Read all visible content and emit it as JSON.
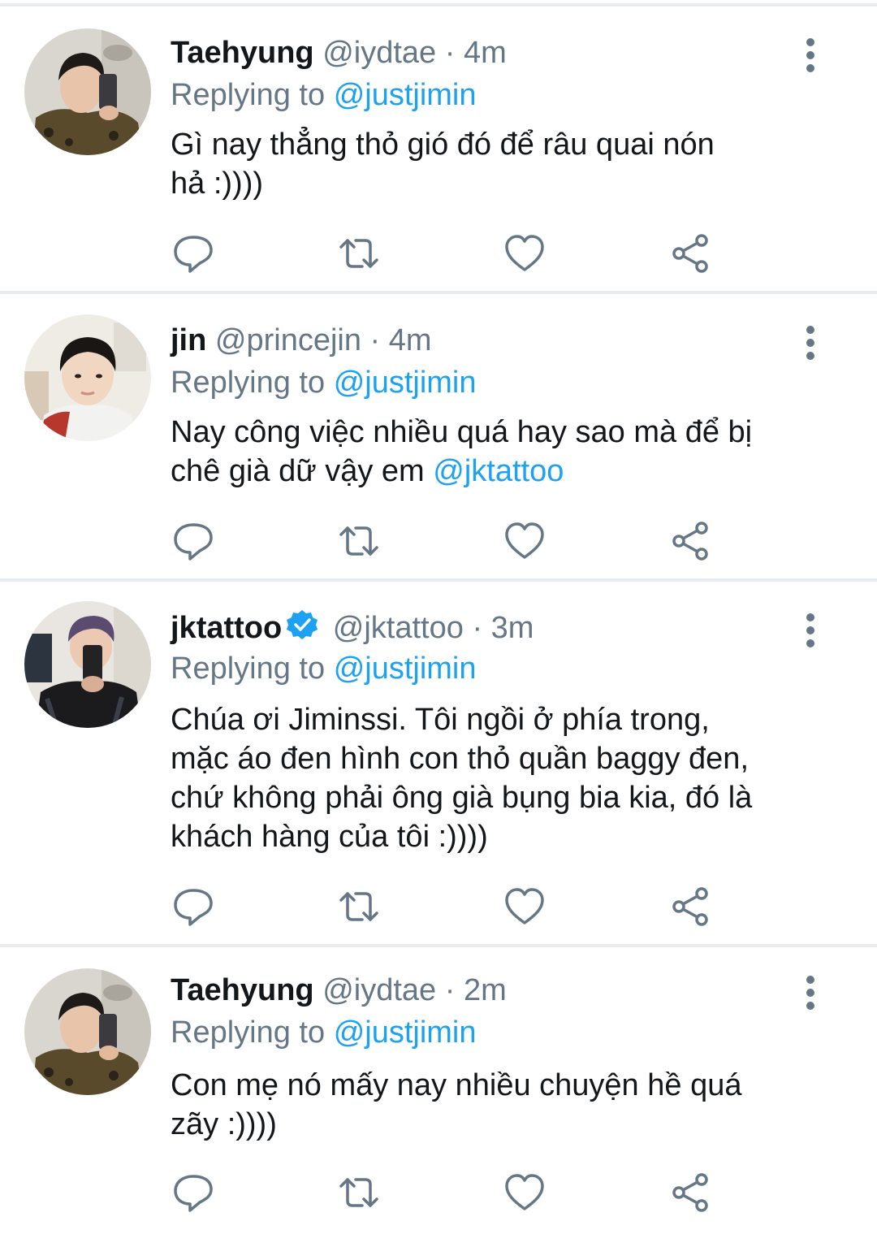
{
  "colors": {
    "name": "#14171a",
    "meta": "#657786",
    "mention": "#1da1f2",
    "separator": "#e6ecf0",
    "verified": "#1da1f2"
  },
  "icons": {
    "reply": "reply-icon",
    "retweet": "retweet-icon",
    "like": "heart-icon",
    "share": "share-icon",
    "more": "more-vertical-icon",
    "verified": "verified-badge-icon"
  },
  "tweets": [
    {
      "name": "Taehyung",
      "handle": "@iydtae",
      "dot": "·",
      "time": "4m",
      "replying_prefix": "Replying to",
      "replying_to": "@justjimin",
      "text_line1": "Gì nay thẳng thỏ gió đó để râu quai nón",
      "text_line2": "hả :))))"
    },
    {
      "name": "jin",
      "handle": "@princejin",
      "dot": "·",
      "time": "4m",
      "replying_prefix": "Replying to",
      "replying_to": "@justjimin",
      "text_line1": "Nay công việc nhiều quá hay sao mà để bị",
      "text_line2": "chê già dữ vậy em ",
      "text_mention": "@jktattoo"
    },
    {
      "name": "jktattoo",
      "verified": true,
      "handle": "@jktattoo",
      "dot": "·",
      "time": "3m",
      "replying_prefix": "Replying to",
      "replying_to": "@justjimin",
      "text_line1": "Chúa ơi Jiminssi. Tôi ngồi ở phía trong,",
      "text_line2": "mặc áo đen hình con thỏ quần baggy đen,",
      "text_line3": "chứ không phải ông già bụng bia kia, đó là",
      "text_line4": "khách hàng của tôi :))))"
    },
    {
      "name": "Taehyung",
      "handle": "@iydtae",
      "dot": "·",
      "time": "2m",
      "replying_prefix": "Replying to",
      "replying_to": "@justjimin",
      "text_line1": "Con mẹ nó mấy nay nhiều chuyện hề quá",
      "text_line2": "zãy :))))"
    }
  ]
}
